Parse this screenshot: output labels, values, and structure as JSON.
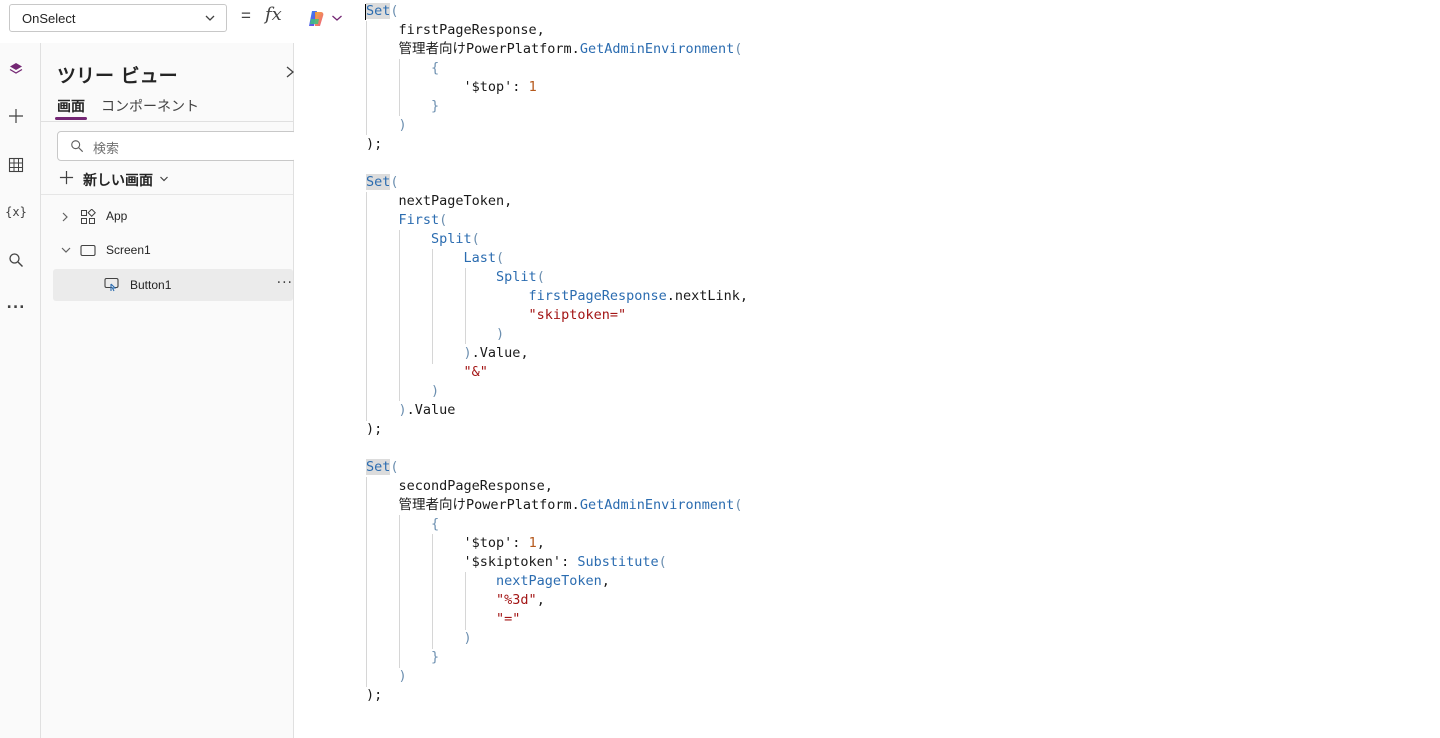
{
  "property_bar": {
    "selected_property": "OnSelect",
    "equals": "=",
    "fx": "fx"
  },
  "rail": {
    "icons": [
      "layers-icon",
      "plus-icon",
      "table-icon",
      "variables-icon",
      "search-icon",
      "more-icon"
    ],
    "variables_glyph": "{x}",
    "more_glyph": "..."
  },
  "tree_view": {
    "title": "ツリー ビュー",
    "tabs": [
      {
        "label": "画面",
        "active": true
      },
      {
        "label": "コンポーネント",
        "active": false
      }
    ],
    "search_placeholder": "検索",
    "new_screen_label": "新しい画面",
    "nodes": [
      {
        "label": "App",
        "expanded": false
      },
      {
        "label": "Screen1",
        "expanded": true
      },
      {
        "label": "Button1",
        "selected": true
      }
    ],
    "more": "···"
  },
  "code": {
    "lines": [
      [
        [
          "kw hl",
          "Set"
        ],
        [
          "punc",
          "("
        ]
      ],
      [
        [
          "var",
          "    firstPageResponse,"
        ]
      ],
      [
        [
          "var",
          "    管理者向けPowerPlatform."
        ],
        [
          "fn",
          "GetAdminEnvironment"
        ],
        [
          "punc",
          "("
        ]
      ],
      [
        [
          "punc",
          "        {"
        ]
      ],
      [
        [
          "var",
          "            '$top': "
        ],
        [
          "num",
          "1"
        ]
      ],
      [
        [
          "punc",
          "        }"
        ]
      ],
      [
        [
          "punc",
          "    )"
        ]
      ],
      [
        [
          "var",
          ");"
        ]
      ],
      [
        [
          "var",
          ""
        ]
      ],
      [
        [
          "kw hl",
          "Set"
        ],
        [
          "punc",
          "("
        ]
      ],
      [
        [
          "var",
          "    nextPageToken,"
        ]
      ],
      [
        [
          "fn",
          "    First"
        ],
        [
          "punc",
          "("
        ]
      ],
      [
        [
          "fn",
          "        Split"
        ],
        [
          "punc",
          "("
        ]
      ],
      [
        [
          "fn",
          "            Last"
        ],
        [
          "punc",
          "("
        ]
      ],
      [
        [
          "fn",
          "                Split"
        ],
        [
          "punc",
          "("
        ]
      ],
      [
        [
          "fn",
          "                    firstPageResponse"
        ],
        [
          "var",
          ".nextLink,"
        ]
      ],
      [
        [
          "str",
          "                    \"skiptoken=\""
        ]
      ],
      [
        [
          "punc",
          "                )"
        ]
      ],
      [
        [
          "punc",
          "            )"
        ],
        [
          "var",
          ".Value,"
        ]
      ],
      [
        [
          "str",
          "            \"&\""
        ]
      ],
      [
        [
          "punc",
          "        )"
        ]
      ],
      [
        [
          "punc",
          "    )"
        ],
        [
          "var",
          ".Value"
        ]
      ],
      [
        [
          "var",
          ");"
        ]
      ],
      [
        [
          "var",
          ""
        ]
      ],
      [
        [
          "kw hl",
          "Set"
        ],
        [
          "punc",
          "("
        ]
      ],
      [
        [
          "var",
          "    secondPageResponse,"
        ]
      ],
      [
        [
          "var",
          "    管理者向けPowerPlatform."
        ],
        [
          "fn",
          "GetAdminEnvironment"
        ],
        [
          "punc",
          "("
        ]
      ],
      [
        [
          "punc",
          "        {"
        ]
      ],
      [
        [
          "var",
          "            '$top': "
        ],
        [
          "num",
          "1"
        ],
        [
          "var",
          ","
        ]
      ],
      [
        [
          "var",
          "            '$skiptoken': "
        ],
        [
          "fn",
          "Substitute"
        ],
        [
          "punc",
          "("
        ]
      ],
      [
        [
          "fn",
          "                nextPageToken"
        ],
        [
          "var",
          ","
        ]
      ],
      [
        [
          "str",
          "                \"%3d\""
        ],
        [
          "var",
          ","
        ]
      ],
      [
        [
          "str",
          "                \"=\""
        ]
      ],
      [
        [
          "punc",
          "            )"
        ]
      ],
      [
        [
          "punc",
          "        }"
        ]
      ],
      [
        [
          "punc",
          "    )"
        ]
      ],
      [
        [
          "var",
          ");"
        ]
      ]
    ]
  }
}
